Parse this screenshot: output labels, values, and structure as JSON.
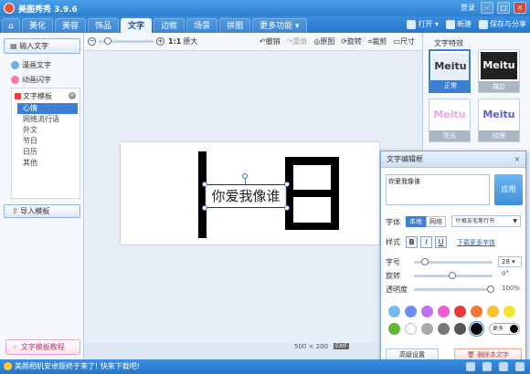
{
  "window": {
    "title": "美图秀秀 3.9.6",
    "login": "登录",
    "minimize": "–",
    "maximize": "□",
    "close": "×"
  },
  "tabs": [
    {
      "label": "美化"
    },
    {
      "label": "美容"
    },
    {
      "label": "饰品"
    },
    {
      "label": "文字"
    },
    {
      "label": "边框"
    },
    {
      "label": "场景"
    },
    {
      "label": "拼图"
    },
    {
      "label": "更多功能 ▾"
    }
  ],
  "menu_right": {
    "open": "打开 ▾",
    "new": "新建",
    "save": "保存与分享"
  },
  "left": {
    "input_text": "输入文字",
    "comic_text": "漫画文字",
    "animated_text": "动画闪字",
    "template_title": "文字模板",
    "template_items": [
      "心情",
      "网络流行语",
      "外文",
      "节日",
      "日历",
      "其他"
    ],
    "import_template": "导入模板",
    "tutorial": "文字模板教程"
  },
  "toolbar": {
    "zoom_minus": "−",
    "zoom_plus": "+",
    "ratio_1to1": "1:1",
    "original_size": "原大",
    "undo": "撤销",
    "redo": "重做",
    "original": "原图",
    "rotate": "旋转",
    "crop": "裁剪",
    "resize": "尺寸"
  },
  "canvas": {
    "text": "你爱我像谁",
    "size": "500 × 200",
    "exif": "EXIF"
  },
  "effects": {
    "title": "文字特效",
    "items": [
      {
        "sample": "Meitu",
        "label": "正常"
      },
      {
        "sample": "Meitu",
        "label": "描边"
      },
      {
        "sample": "Meitu",
        "label": "荧光"
      },
      {
        "sample": "Meitu",
        "label": "纹理"
      }
    ]
  },
  "dialog": {
    "title": "文字编辑框",
    "close": "×",
    "textarea": "你爱我像谁",
    "apply": "应用",
    "font_label": "字体",
    "font_local": "本地",
    "font_online": "网络",
    "font_selected": "叶根友毛笔行书",
    "style_label": "样式",
    "bold": "B",
    "italic": "I",
    "underline": "U",
    "more_fonts": "下载更多字体",
    "size_label": "字号",
    "size_value": "28 ▾",
    "rotate_label": "旋转",
    "rotate_value": "0°",
    "opacity_label": "透明度",
    "opacity_value": "100%",
    "more_colors": "更多",
    "advanced": "高级设置",
    "delete_text": "删除本文字",
    "colors_row1": [
      "#7ab8f0",
      "#6a8ff2",
      "#c26ef0",
      "#f05ad0",
      "#e83a3a",
      "#f07830",
      "#f5c030",
      "#f0e830"
    ],
    "colors_row2": [
      "#5fb830",
      "#ffffff",
      "#aaaaaa",
      "#777777",
      "#555555",
      "#000000"
    ]
  },
  "status": {
    "message": "美颜相机安卓版终于来了! 快来下载吧!"
  }
}
